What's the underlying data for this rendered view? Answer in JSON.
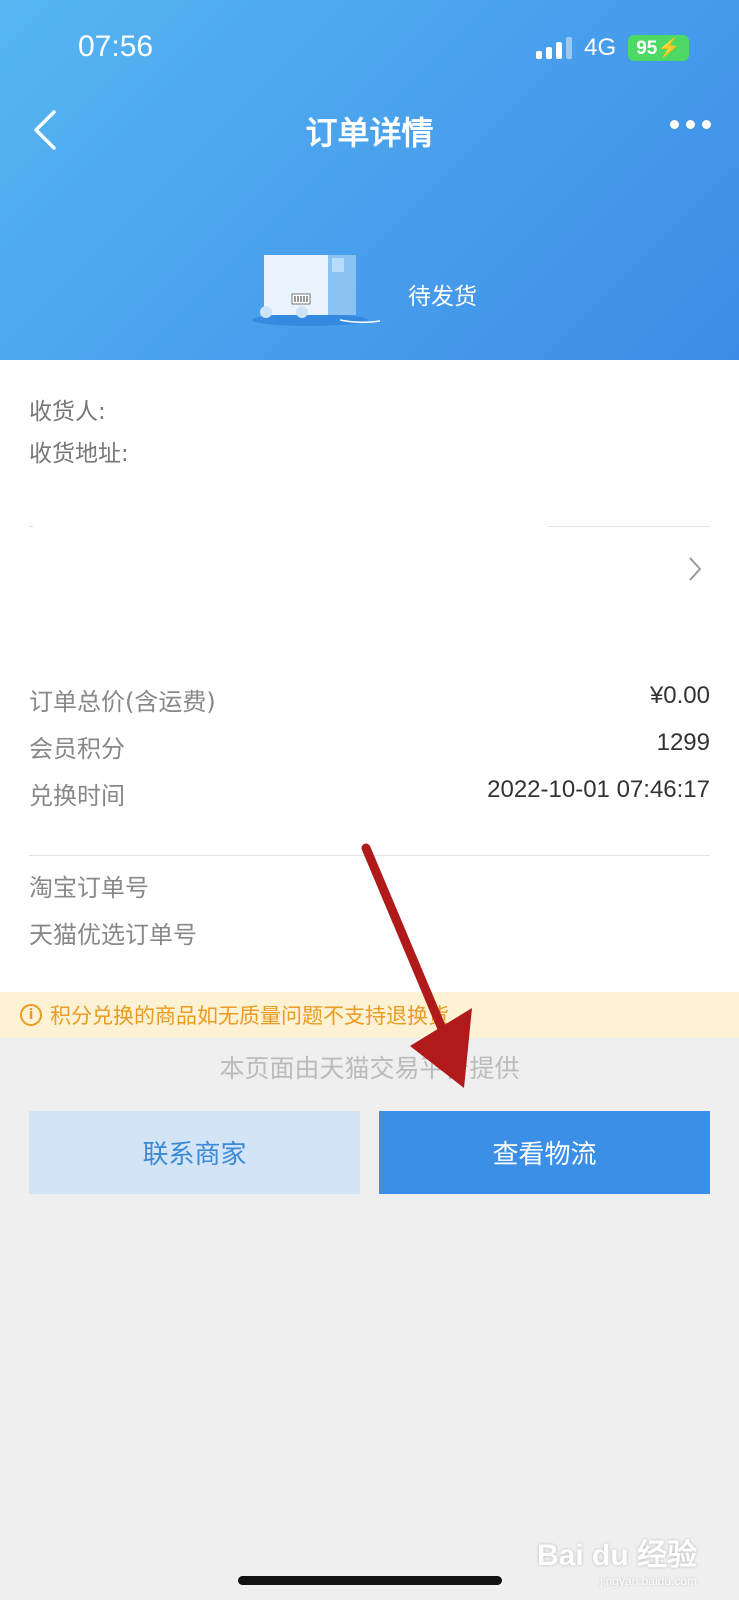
{
  "status_bar": {
    "time": "07:56",
    "network": "4G",
    "battery": "95"
  },
  "nav": {
    "title": "订单详情"
  },
  "order_status": {
    "text": "待发货"
  },
  "address": {
    "receiver_label": "收货人:",
    "address_label": "收货地址:"
  },
  "summary": [
    {
      "label": "订单总价(含运费)",
      "value": "¥0.00"
    },
    {
      "label": "会员积分",
      "value": "1299"
    },
    {
      "label": "兑换时间",
      "value": "2022-10-01 07:46:17"
    }
  ],
  "order_numbers": {
    "taobao_label": "淘宝订单号",
    "tmall_label": "天猫优选订单号"
  },
  "notice": {
    "icon": "info-icon",
    "text": "积分兑换的商品如无质量问题不支持退换货"
  },
  "footer_note": "本页面由天猫交易平台提供",
  "buttons": {
    "contact": "联系商家",
    "logistics": "查看物流"
  },
  "watermark": {
    "text": "Bai du 经验",
    "sub": "jingyan.baidu.com"
  },
  "colors": {
    "header_start": "#56b6f2",
    "header_end": "#3d8ce7",
    "primary_button": "#3b8fe6",
    "secondary_button": "#d2e4f6",
    "notice_bg": "#fdf2d3",
    "notice_text": "#e99b22",
    "arrow": "#b01a1a"
  }
}
